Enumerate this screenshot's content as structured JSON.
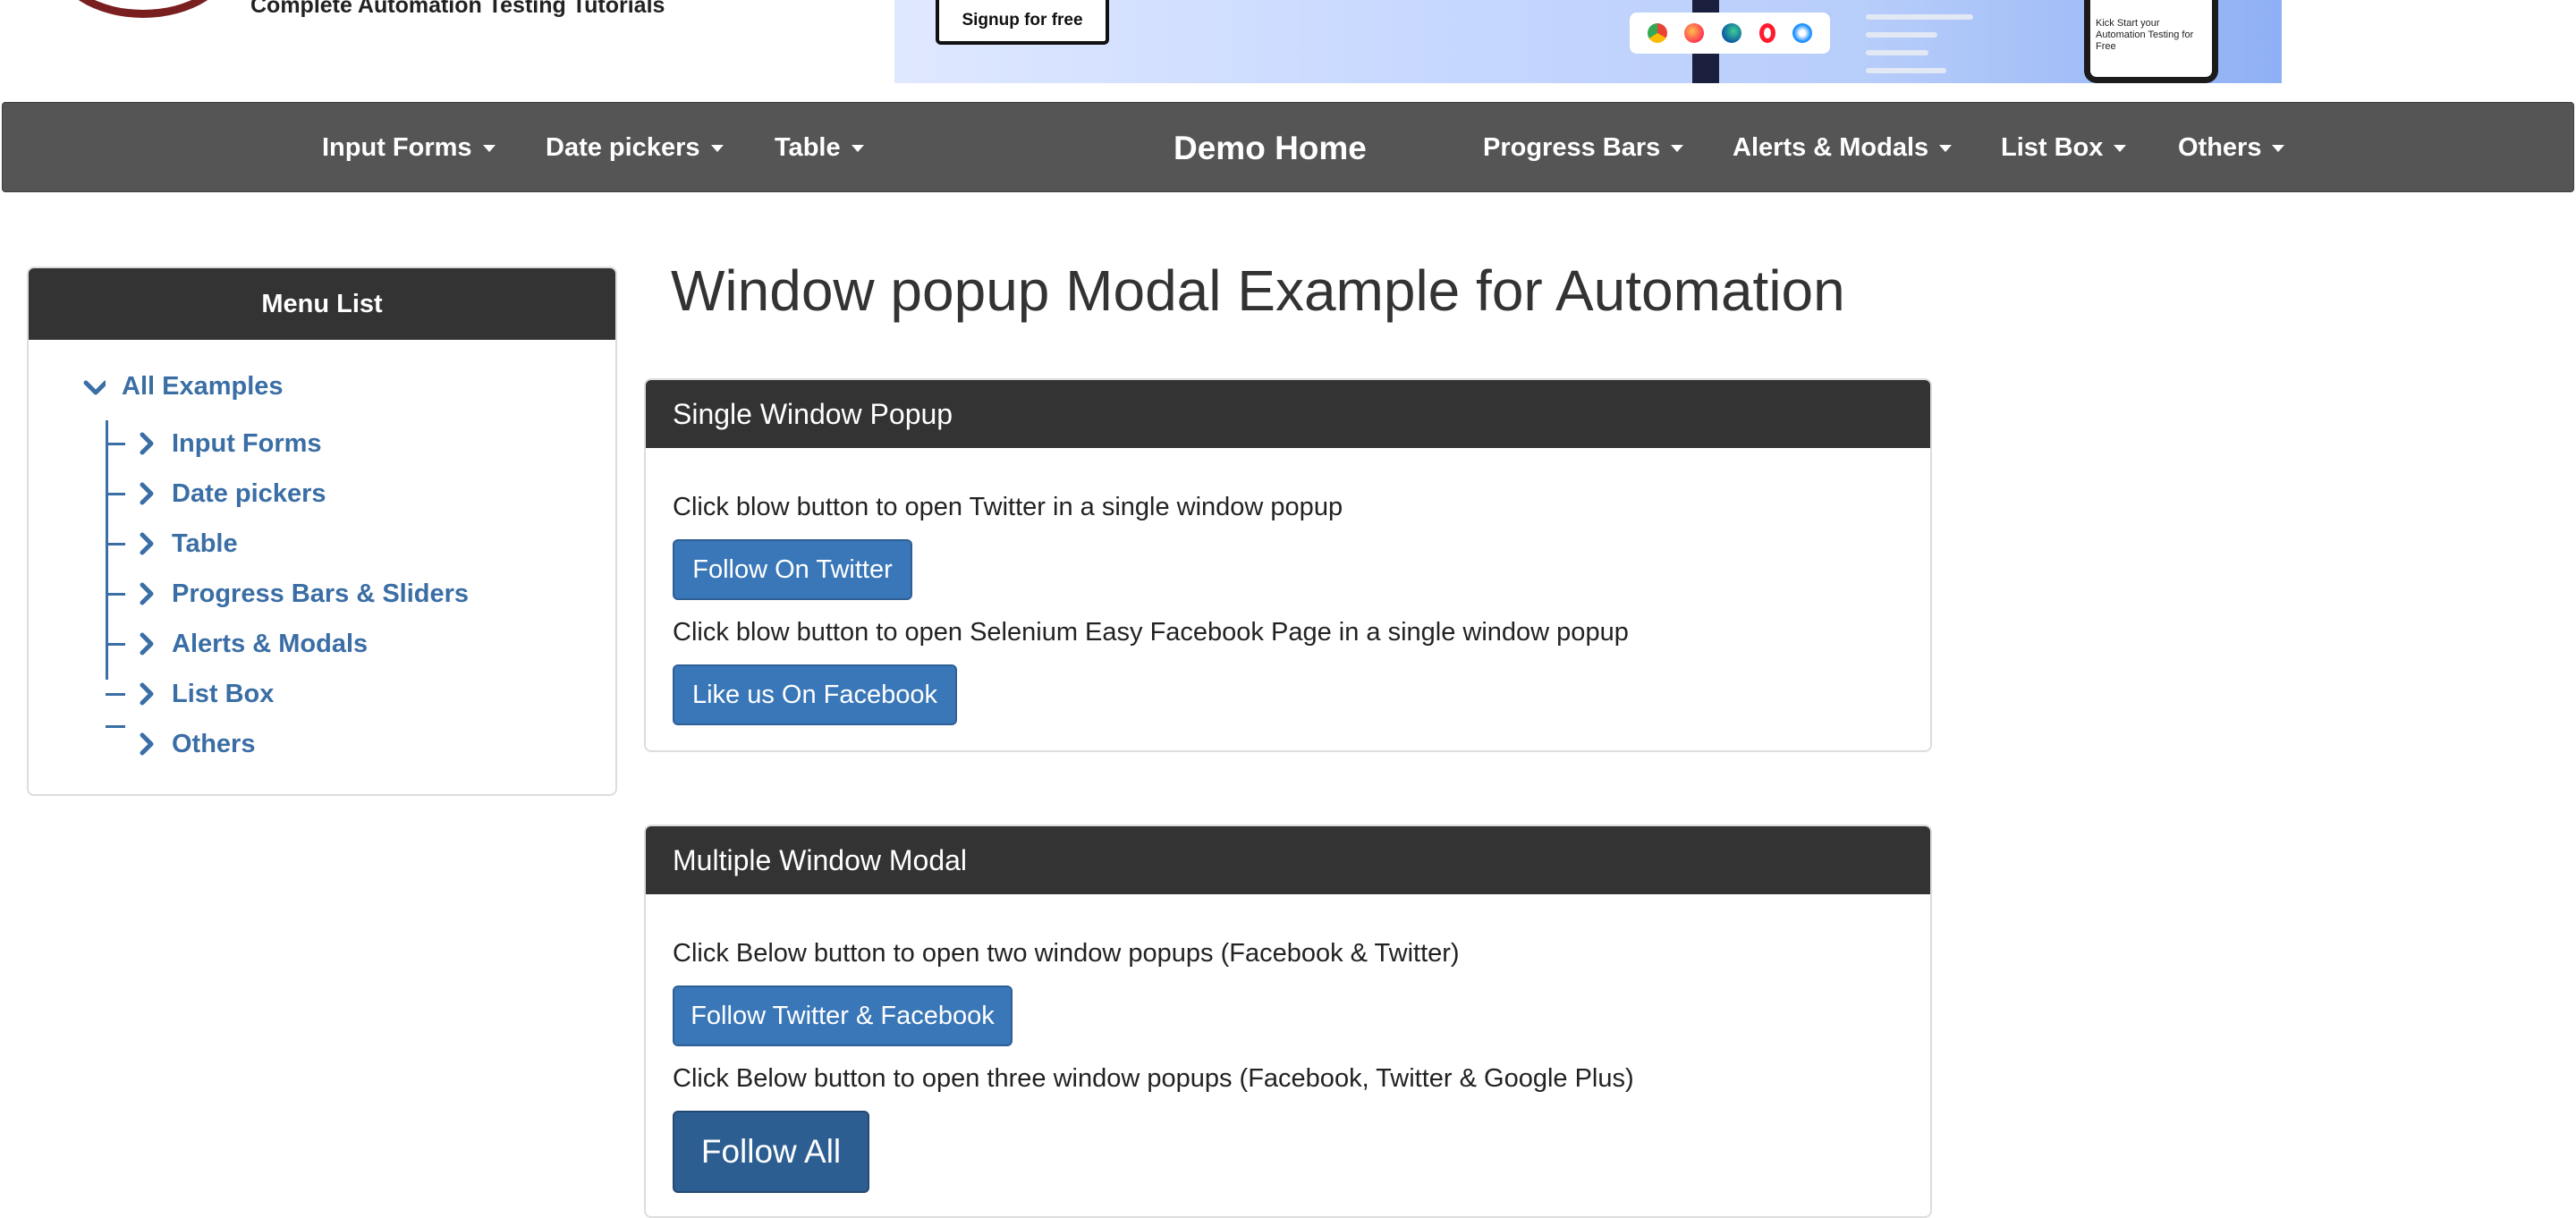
{
  "header": {
    "tagline": "Complete Automation Testing Tutorials",
    "banner": {
      "signup_label": "Signup for free",
      "phone_text": "Kick Start your Automation Testing for Free"
    }
  },
  "nav": {
    "items": [
      {
        "label": "Input Forms"
      },
      {
        "label": "Date pickers"
      },
      {
        "label": "Table"
      },
      {
        "label": "Demo Home"
      },
      {
        "label": "Progress Bars"
      },
      {
        "label": "Alerts & Modals"
      },
      {
        "label": "List Box"
      },
      {
        "label": "Others"
      }
    ]
  },
  "sidebar": {
    "title": "Menu List",
    "root": "All Examples",
    "items": [
      {
        "label": "Input Forms"
      },
      {
        "label": "Date pickers"
      },
      {
        "label": "Table"
      },
      {
        "label": "Progress Bars & Sliders"
      },
      {
        "label": "Alerts & Modals"
      },
      {
        "label": "List Box"
      },
      {
        "label": "Others"
      }
    ]
  },
  "main": {
    "title": "Window popup Modal Example for Automation",
    "single": {
      "header": "Single Window Popup",
      "text1": "Click blow button to open Twitter in a single window popup",
      "button1": "Follow On Twitter",
      "text2": "Click blow button to open Selenium Easy Facebook Page in a single window popup",
      "button2": "Like us On Facebook"
    },
    "multiple": {
      "header": "Multiple Window Modal",
      "text1": "Click Below button to open two window popups (Facebook & Twitter)",
      "button1": "Follow Twitter & Facebook",
      "text2": "Click Below button to open three window popups (Facebook, Twitter & Google Plus)",
      "button2": "Follow All"
    }
  },
  "colors": {
    "navbar": "#555555",
    "panel_header": "#333333",
    "link": "#3a6ea5",
    "button": "#3a77b8",
    "button_large": "#2d5e91"
  }
}
